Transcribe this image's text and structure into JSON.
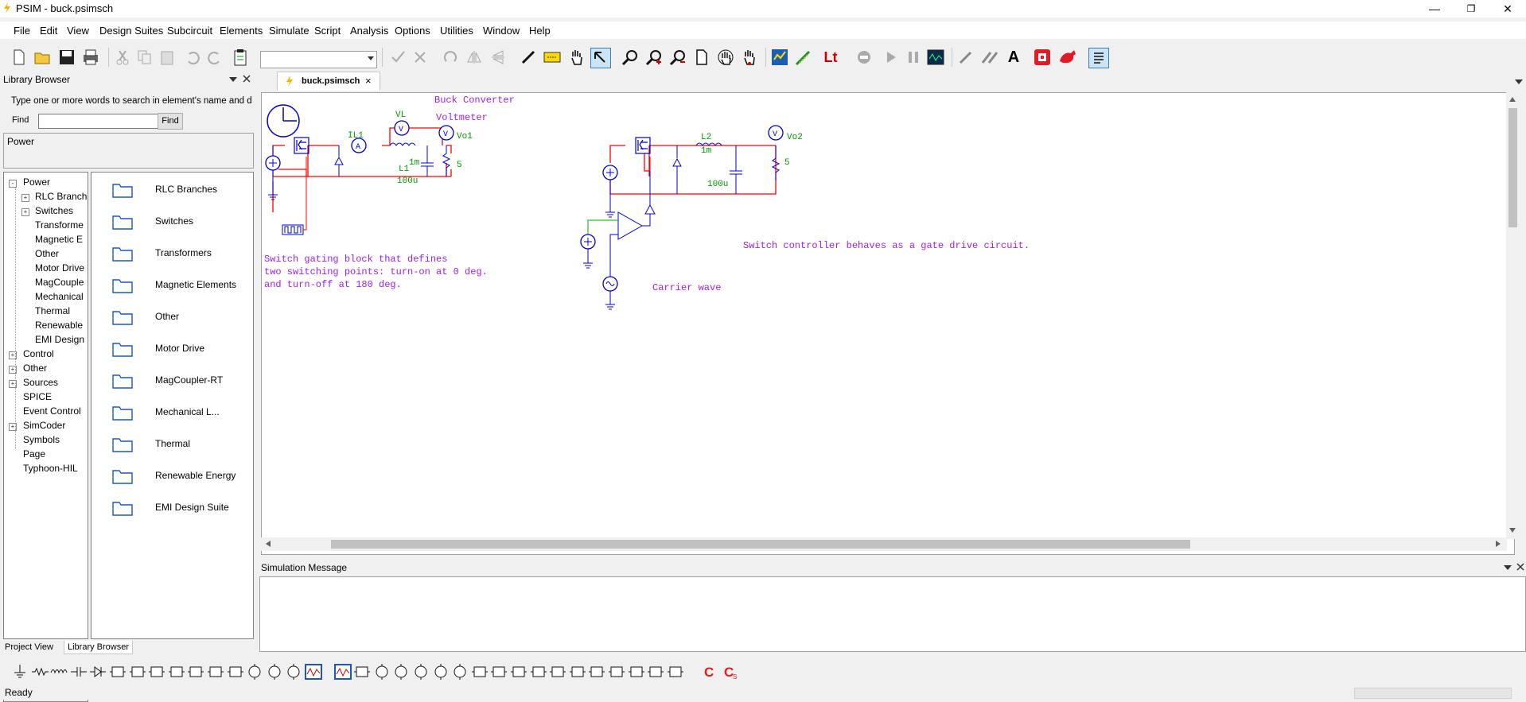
{
  "window": {
    "title": "PSIM - buck.psimsch",
    "min_glyph": "—",
    "max_glyph": "❐",
    "close_glyph": "✕"
  },
  "menu": [
    "File",
    "Edit",
    "View",
    "Design Suites",
    "Subcircuit",
    "Elements",
    "Simulate",
    "Script",
    "Analysis",
    "Options",
    "Utilities",
    "Window",
    "Help"
  ],
  "toolbar": {
    "combo_value": "",
    "icons": [
      "new-icon",
      "open-icon",
      "save-icon",
      "print-icon",
      "cut-icon",
      "copy-icon",
      "paste-icon",
      "undo-icon",
      "redo-icon",
      "clipboard-icon",
      "check-icon",
      "cross-icon",
      "rotate-icon",
      "flip-horizontal-icon",
      "flip-vertical-icon",
      "wire-icon",
      "label-icon",
      "hand-icon",
      "select-icon",
      "zoom-icon",
      "zoom-in-icon",
      "zoom-out-icon",
      "page-icon",
      "pan-icon",
      "grab-icon",
      "run-icon",
      "probe-icon",
      "lt-icon",
      "stop-icon",
      "play-icon",
      "pause-icon",
      "scope-icon",
      "pen-icon",
      "multi-pen-icon",
      "text-icon",
      "red-app-icon",
      "red-animal-icon",
      "list-icon"
    ],
    "lt_label": "Lt",
    "text_label": "A"
  },
  "library": {
    "title": "Library Browser",
    "search_hint": "Type one or more words to search in element's name and  desc",
    "find_label": "Find",
    "find_value": "",
    "find_button": "Find",
    "selected_category": "Power",
    "tree": [
      {
        "label": "Power",
        "level": 0,
        "expander": "-"
      },
      {
        "label": "RLC Branch",
        "level": 1,
        "expander": "+"
      },
      {
        "label": "Switches",
        "level": 1,
        "expander": "+"
      },
      {
        "label": "Transforme",
        "level": 1,
        "expander": ""
      },
      {
        "label": "Magnetic E",
        "level": 1,
        "expander": ""
      },
      {
        "label": "Other",
        "level": 1,
        "expander": ""
      },
      {
        "label": "Motor Drive",
        "level": 1,
        "expander": ""
      },
      {
        "label": "MagCouple",
        "level": 1,
        "expander": ""
      },
      {
        "label": "Mechanical",
        "level": 1,
        "expander": ""
      },
      {
        "label": "Thermal",
        "level": 1,
        "expander": ""
      },
      {
        "label": "Renewable",
        "level": 1,
        "expander": ""
      },
      {
        "label": "EMI Design",
        "level": 1,
        "expander": ""
      },
      {
        "label": "Control",
        "level": 0,
        "expander": "+"
      },
      {
        "label": "Other",
        "level": 0,
        "expander": "+"
      },
      {
        "label": "Sources",
        "level": 0,
        "expander": "+"
      },
      {
        "label": "SPICE",
        "level": 0,
        "expander": ""
      },
      {
        "label": "Event Control",
        "level": 0,
        "expander": ""
      },
      {
        "label": "SimCoder",
        "level": 0,
        "expander": "+"
      },
      {
        "label": "Symbols",
        "level": 0,
        "expander": ""
      },
      {
        "label": "Page",
        "level": 0,
        "expander": ""
      },
      {
        "label": "Typhoon-HIL",
        "level": 0,
        "expander": ""
      }
    ],
    "folders": [
      "RLC Branches",
      "Switches",
      "Transformers",
      "Magnetic Elements",
      "Other",
      "Motor Drive",
      "MagCoupler-RT",
      "Mechanical L...",
      "Thermal",
      "Renewable Energy",
      "EMI Design Suite"
    ],
    "tabs": [
      "Project View",
      "Library Browser"
    ]
  },
  "document": {
    "tab_label": "buck.psimsch",
    "tab_close": "×",
    "schematic": {
      "title": "Buck Converter",
      "voltmeter_label": "Voltmeter",
      "il1": "IL1",
      "vl": "VL",
      "l1_value": "1m",
      "l1": "L1",
      "c1_value": "100u",
      "r1_value": "5",
      "vo1": "Vo1",
      "l2": "L2",
      "l2_value": "1m",
      "c2_value": "100u",
      "r2_value": "5",
      "vo2": "Vo2",
      "ammeter_glyph": "A",
      "voltmeter_glyph": "V",
      "note1": [
        "Switch gating block that defines",
        "two switching points: turn-on at 0 deg.",
        "and turn-off at 180 deg."
      ],
      "note2": "Switch controller behaves as a gate drive circuit.",
      "carrier": "Carrier wave"
    }
  },
  "sim_message": {
    "title": "Simulation Message",
    "text": ""
  },
  "element_toolbar": [
    "ground-icon",
    "resistor-icon",
    "inductor-icon",
    "capacitor-icon",
    "diode-icon",
    "thyristor-icon",
    "transistor-icon",
    "bridge-icon",
    "bridge2-icon",
    "gating-icon",
    "switch-icon",
    "switch2-icon",
    "voltmeter-icon",
    "voltmeter2-icon",
    "ammeter-icon",
    "scope-icon",
    "scope2-icon",
    "block-icon",
    "dc-source-icon",
    "ac-source-icon",
    "source3-icon",
    "source4-icon",
    "source5-icon",
    "amp-icon",
    "probe-icon",
    "k-block-icon",
    "pi-block-icon",
    "sum-icon",
    "multiplier-icon",
    "comparator-icon",
    "limiter-icon",
    "triangle-icon",
    "mult-block-icon",
    "add-block-icon",
    "c-code-icon",
    "cs-code-icon"
  ],
  "status": {
    "text": "Ready"
  },
  "colors": {
    "wire": "#ff0000",
    "component": "#0000cc",
    "label_green": "#009900",
    "note_purple": "#a020f0"
  }
}
